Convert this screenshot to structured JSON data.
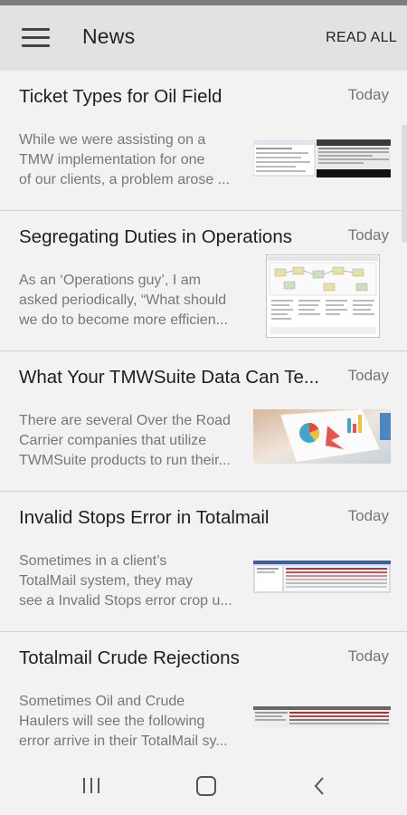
{
  "header": {
    "menu_icon": "hamburger-icon",
    "title": "News",
    "read_all": "READ ALL"
  },
  "articles": [
    {
      "title": "Ticket Types for Oil Field",
      "date": "Today",
      "snippet": [
        "While we were assisting on a",
        "TMW implementation for one",
        "of our clients, a problem arose ..."
      ],
      "thumbnail": "screenshot-thumbnail"
    },
    {
      "title": "Segregating Duties in Operations",
      "date": "Today",
      "snippet": [
        "As an ‘Operations guy’, I am",
        "asked periodically, “What should",
        "we do to become more efficien..."
      ],
      "thumbnail": "flowchart-thumbnail"
    },
    {
      "title": "What Your TMWSuite Data Can Te...",
      "date": "Today",
      "snippet": [
        "There are several Over the Road",
        "Carrier companies that utilize",
        "TWMSuite products to run their..."
      ],
      "thumbnail": "charts-photo-thumbnail"
    },
    {
      "title": "Invalid Stops Error in Totalmail",
      "date": "Today",
      "snippet": [
        "Sometimes in a client’s",
        "TotalMail system, they may",
        "see a Invalid Stops error crop u..."
      ],
      "thumbnail": "error-screenshot-thumbnail"
    },
    {
      "title": "Totalmail Crude Rejections",
      "date": "Today",
      "snippet": [
        "Sometimes Oil and Crude",
        "Haulers will see the following",
        "error arrive in their TotalMail sy..."
      ],
      "thumbnail": "table-screenshot-thumbnail"
    }
  ],
  "navigation": {
    "recents": "recent-apps-icon",
    "home": "home-icon",
    "back": "back-icon"
  }
}
